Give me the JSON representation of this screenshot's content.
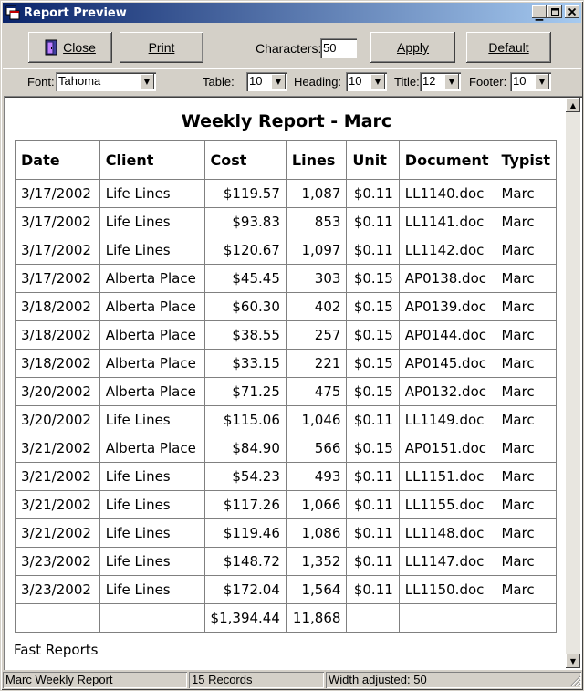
{
  "window": {
    "title": "Report Preview",
    "controls": {
      "minimize": "_",
      "maximize": "□",
      "close": "✕"
    }
  },
  "toolbar": {
    "close_label": "Close",
    "print_label": "Print",
    "characters_label": "Characters:",
    "characters_value": "50",
    "apply_label": "Apply",
    "default_label": "Default"
  },
  "options": {
    "font_label": "Font:",
    "font_value": "Tahoma",
    "table_label": "Table:",
    "table_value": "10",
    "heading_label": "Heading:",
    "heading_value": "10",
    "title_label": "Title:",
    "title_value": "12",
    "footer_label": "Footer:",
    "footer_value": "10"
  },
  "report": {
    "title": "Weekly Report - Marc",
    "columns": [
      "Date",
      "Client",
      "Cost",
      "Lines",
      "Unit",
      "Document",
      "Typist"
    ],
    "rows": [
      [
        "3/17/2002",
        "Life Lines",
        "$119.57",
        "1,087",
        "$0.11",
        "LL1140.doc",
        "Marc"
      ],
      [
        "3/17/2002",
        "Life Lines",
        "$93.83",
        "853",
        "$0.11",
        "LL1141.doc",
        "Marc"
      ],
      [
        "3/17/2002",
        "Life Lines",
        "$120.67",
        "1,097",
        "$0.11",
        "LL1142.doc",
        "Marc"
      ],
      [
        "3/17/2002",
        "Alberta Place",
        "$45.45",
        "303",
        "$0.15",
        "AP0138.doc",
        "Marc"
      ],
      [
        "3/18/2002",
        "Alberta Place",
        "$60.30",
        "402",
        "$0.15",
        "AP0139.doc",
        "Marc"
      ],
      [
        "3/18/2002",
        "Alberta Place",
        "$38.55",
        "257",
        "$0.15",
        "AP0144.doc",
        "Marc"
      ],
      [
        "3/18/2002",
        "Alberta Place",
        "$33.15",
        "221",
        "$0.15",
        "AP0145.doc",
        "Marc"
      ],
      [
        "3/20/2002",
        "Alberta Place",
        "$71.25",
        "475",
        "$0.15",
        "AP0132.doc",
        "Marc"
      ],
      [
        "3/20/2002",
        "Life Lines",
        "$115.06",
        "1,046",
        "$0.11",
        "LL1149.doc",
        "Marc"
      ],
      [
        "3/21/2002",
        "Alberta Place",
        "$84.90",
        "566",
        "$0.15",
        "AP0151.doc",
        "Marc"
      ],
      [
        "3/21/2002",
        "Life Lines",
        "$54.23",
        "493",
        "$0.11",
        "LL1151.doc",
        "Marc"
      ],
      [
        "3/21/2002",
        "Life Lines",
        "$117.26",
        "1,066",
        "$0.11",
        "LL1155.doc",
        "Marc"
      ],
      [
        "3/21/2002",
        "Life Lines",
        "$119.46",
        "1,086",
        "$0.11",
        "LL1148.doc",
        "Marc"
      ],
      [
        "3/23/2002",
        "Life Lines",
        "$148.72",
        "1,352",
        "$0.11",
        "LL1147.doc",
        "Marc"
      ],
      [
        "3/23/2002",
        "Life Lines",
        "$172.04",
        "1,564",
        "$0.11",
        "LL1150.doc",
        "Marc"
      ]
    ],
    "totals": [
      "",
      "",
      "$1,394.44",
      "11,868",
      "",
      "",
      ""
    ],
    "footer": "Fast Reports"
  },
  "status": {
    "report_name": "Marc Weekly Report",
    "records": "15 Records",
    "width_info": "Width adjusted: 50"
  },
  "colors": {
    "title_bar_start": "#0a246a",
    "title_bar_end": "#a6caf0",
    "face": "#d4d0c8"
  }
}
